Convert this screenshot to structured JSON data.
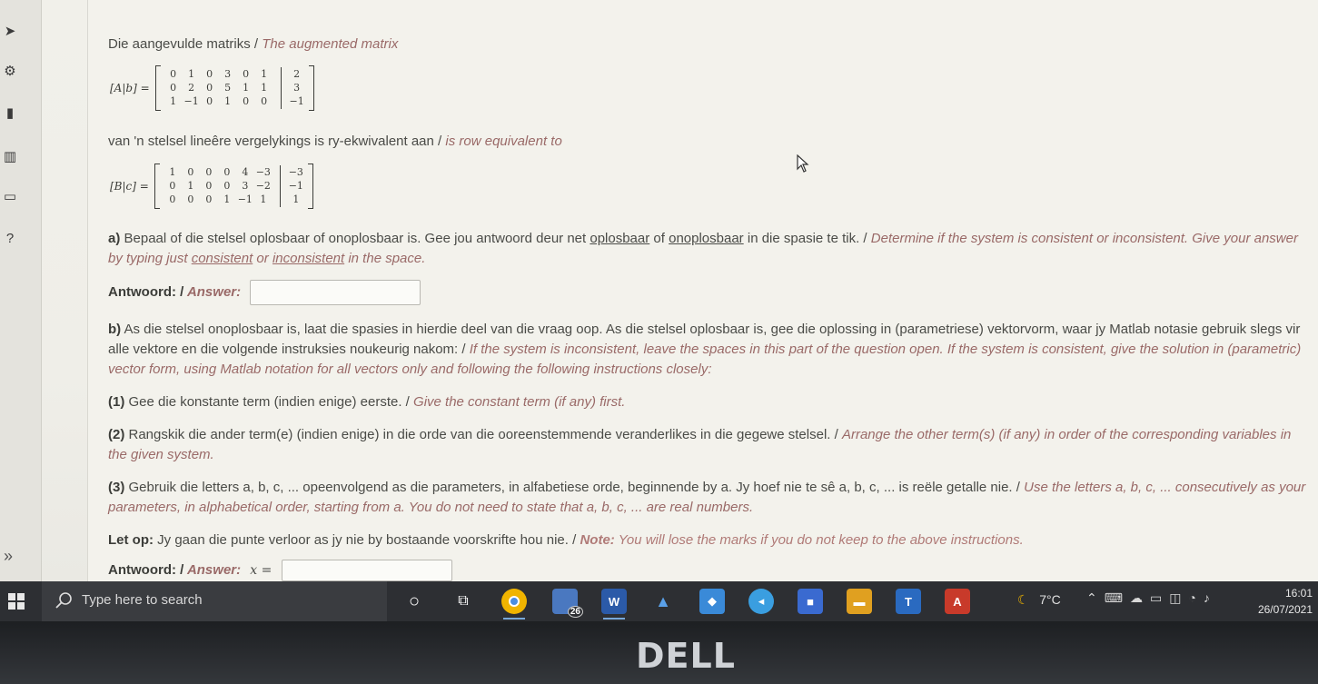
{
  "heading": {
    "af": "Die aangevulde matriks",
    "sep": " / ",
    "en": "The augmented matrix"
  },
  "matrix_A": {
    "label": "[A|b] =",
    "rows": [
      [
        "0",
        "1",
        "0",
        "3",
        "0",
        "1"
      ],
      [
        "0",
        "2",
        "0",
        "5",
        "1",
        "1"
      ],
      [
        "1",
        "−1",
        "0",
        "1",
        "0",
        "0"
      ]
    ],
    "rhs": [
      "2",
      "3",
      "−1"
    ]
  },
  "equiv": {
    "af": "van 'n stelsel lineêre vergelykings is ry-ekwivalent aan",
    "sep": " / ",
    "en": "is row equivalent to"
  },
  "matrix_B": {
    "label": "[B|c] =",
    "rows": [
      [
        "1",
        "0",
        "0",
        "0",
        "4",
        "−3"
      ],
      [
        "0",
        "1",
        "0",
        "0",
        "3",
        "−2"
      ],
      [
        "0",
        "0",
        "0",
        "1",
        "−1",
        "1"
      ]
    ],
    "rhs": [
      "−3",
      "−1",
      "1"
    ]
  },
  "part_a": {
    "label": "a)",
    "af1": " Bepaal of die stelsel oplosbaar of onoplosbaar is. Gee jou antwoord deur net ",
    "af_w1": "oplosbaar",
    "af2": " of ",
    "af_w2": "onoplosbaar",
    "af3": " in die spasie te tik.",
    "sep": " / ",
    "en1": "Determine if the system is consistent or inconsistent. Give your answer by typing just ",
    "en_w1": "consistent",
    "en2": " or ",
    "en_w2": "inconsistent",
    "en3": " in the space."
  },
  "answer_a": {
    "af": "Antwoord: /",
    "en": " Answer:"
  },
  "part_b": {
    "label": "b)",
    "af": " As die stelsel onoplosbaar is, laat die spasies in hierdie deel van die vraag oop. As die stelsel oplosbaar is, gee die oplossing in (parametriese) vektorvorm, waar jy Matlab notasie gebruik slegs vir alle vektore en die volgende instruksies noukeurig nakom:",
    "sep": " / ",
    "en": "If the system is inconsistent, leave the spaces in this part of the question open. If the system is consistent, give the solution in (parametric) vector form, using Matlab notation for all vectors only and following the following instructions closely:"
  },
  "step1": {
    "num": "(1)",
    "af": " Gee die konstante term (indien enige) eerste.",
    "sep": " / ",
    "en": "Give the constant term (if any) first."
  },
  "step2": {
    "num": "(2)",
    "af": " Rangskik die ander term(e) (indien enige) in die orde van die ooreenstemmende veranderlikes in die gegewe stelsel.",
    "sep": " / ",
    "en": "Arrange the other term(s) (if any) in order of the corresponding variables in the given system."
  },
  "step3": {
    "num": "(3)",
    "af": " Gebruik die letters a, b, c, ... opeenvolgend as die parameters, in alfabetiese orde, beginnende by a. Jy hoef nie te sê a, b, c, ... is reële getalle nie.",
    "sep": " / ",
    "en": "Use the letters a, b, c, ... consecutively as your parameters, in alphabetical order, starting from a. You do not need to state that a, b, c, ...  are real numbers."
  },
  "note": {
    "af_label": "Let op:",
    "af": " Jy gaan die punte verloor as jy nie by bostaande voorskrifte hou nie.",
    "sep": " / ",
    "en_label": "Note:",
    "en": " You will lose the marks if you do not keep to the above instructions."
  },
  "answer_b": {
    "af": "Antwoord: /",
    "en": " Answer:",
    "var": "x ="
  },
  "taskbar": {
    "search_placeholder": "Type here to search",
    "badge": "26",
    "weather": "7°C",
    "time": "16:01",
    "date": "26/07/2021"
  },
  "bezel": {
    "brand": "DELL"
  },
  "colors": {
    "accent_en": "#9a6a68",
    "text": "#4a4b47",
    "taskbar": "#2d2f33"
  }
}
